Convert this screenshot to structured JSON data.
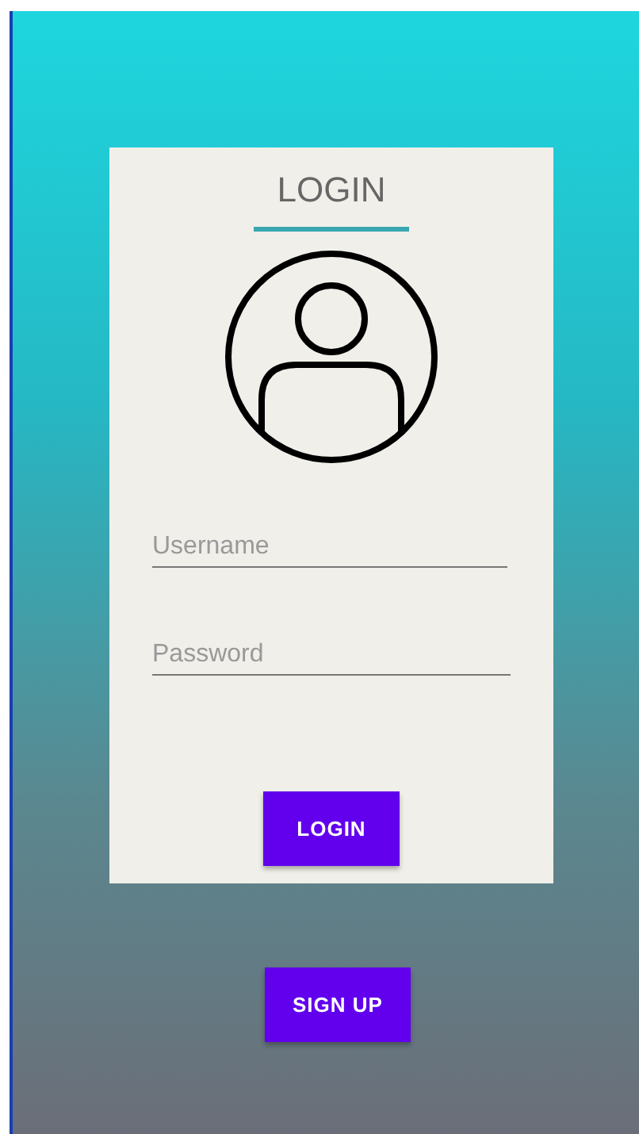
{
  "card": {
    "title": "LOGIN",
    "username": {
      "placeholder": "Username"
    },
    "password": {
      "placeholder": "Password"
    },
    "login_button": "LOGIN"
  },
  "signup_button": "SIGN UP"
}
